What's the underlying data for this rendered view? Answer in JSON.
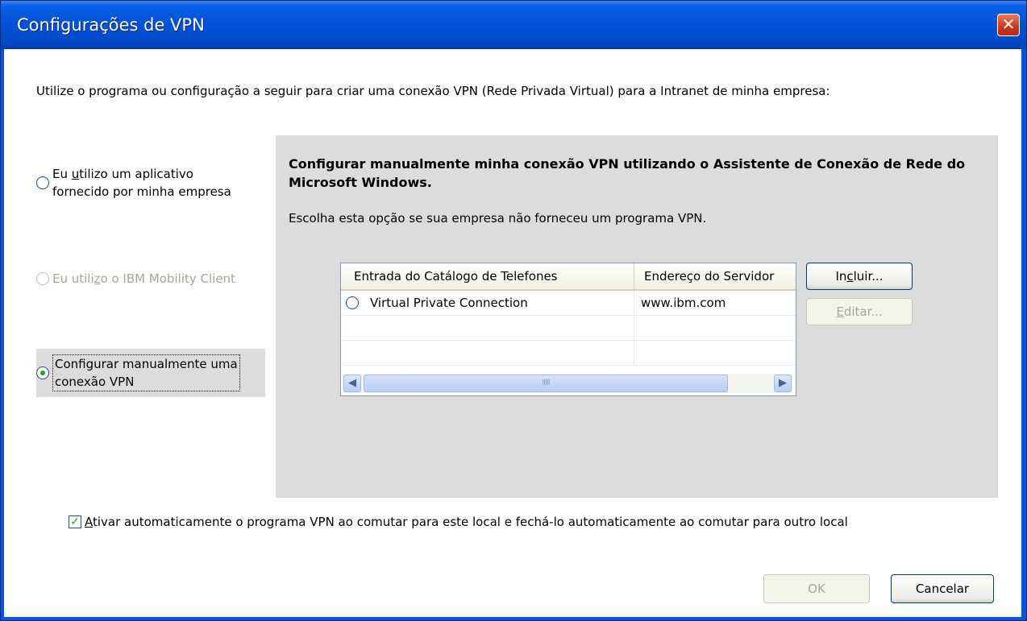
{
  "window": {
    "title": "Configurações de VPN",
    "close_glyph": "✕"
  },
  "intro": "Utilize o programa ou configuração a seguir para criar uma conexão VPN (Rede Privada Virtual) para a Intranet de minha empresa:",
  "options": {
    "company_app": {
      "line1_pre": "Eu ",
      "line1_mnemonic": "u",
      "line1_post": "tilizo um aplicativo",
      "line2": "fornecido por minha empresa",
      "selected": false,
      "enabled": true
    },
    "ibm_client": {
      "pre": "Eu utili",
      "mnemonic": "z",
      "post": "o o IBM Mobility Client",
      "selected": false,
      "enabled": false
    },
    "manual": {
      "line1": "Configurar manualmente uma",
      "line2": "conexão VPN",
      "selected": true,
      "enabled": true
    }
  },
  "panel": {
    "heading": "Configurar manualmente minha conexão VPN utilizando o Assistente de Conexão de Rede do Microsoft Windows.",
    "description": "Escolha esta opção se sua empresa não forneceu um programa VPN."
  },
  "list": {
    "columns": [
      "Entrada do Catálogo de Telefones",
      "Endereço do Servidor"
    ],
    "rows": [
      {
        "entry": "Virtual Private Connection",
        "server": "www.ibm.com",
        "selected": false
      }
    ]
  },
  "buttons": {
    "add": {
      "pre": "In",
      "mnemonic": "c",
      "post": "luir..."
    },
    "edit": {
      "pre": "",
      "mnemonic": "E",
      "post": "ditar..."
    },
    "ok": "OK",
    "cancel": "Cancelar"
  },
  "auto_toggle": {
    "mnemonic": "A",
    "post": "tivar automaticamente o programa VPN ao comutar para este local e fechá-lo automaticamente ao comutar para outro local",
    "checked": true
  },
  "scrollbar": {
    "left_glyph": "◀",
    "right_glyph": "▶",
    "grip": "IIIII"
  },
  "colors": {
    "title_bar": "#0054e3",
    "panel_bg": "#dcdcdc",
    "radio_dot": "#21a121",
    "disabled_text": "#a8a69a"
  }
}
